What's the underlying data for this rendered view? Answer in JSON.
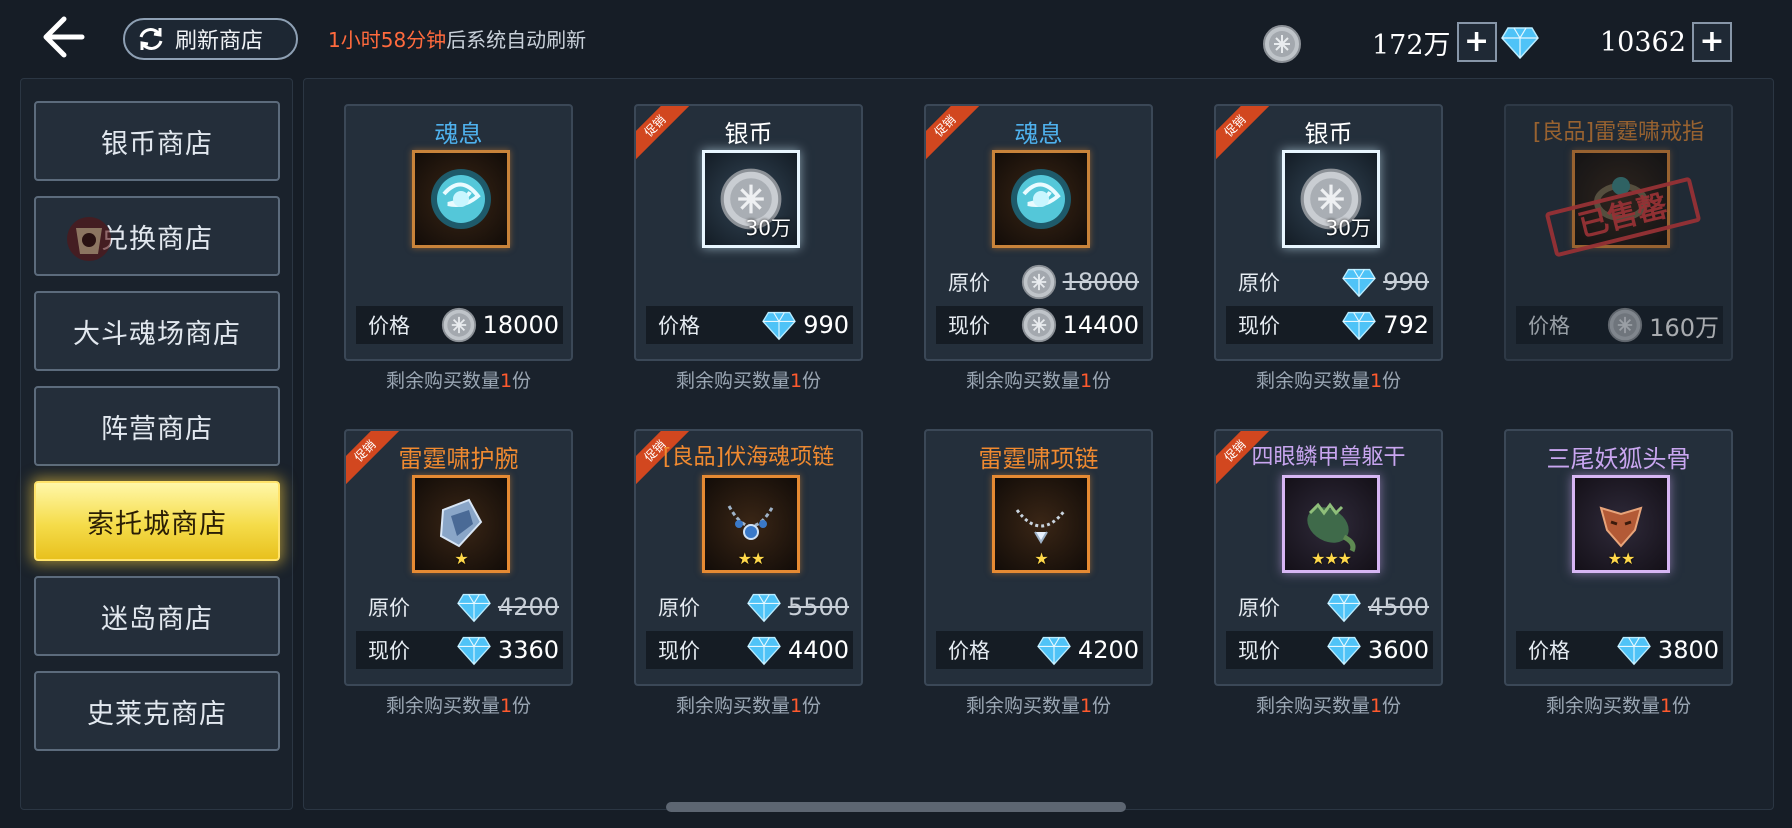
{
  "header": {
    "refresh_label": "刷新商店",
    "refresh_time": "1小时58分钟",
    "refresh_suffix": "后系统自动刷新",
    "silver_amount": "172万",
    "diamond_amount": "10362"
  },
  "sidebar": {
    "items": [
      {
        "label": "银币商店",
        "active": false
      },
      {
        "label": "兑换商店",
        "active": false
      },
      {
        "label": "大斗魂场商店",
        "active": false
      },
      {
        "label": "阵营商店",
        "active": false
      },
      {
        "label": "索托城商店",
        "active": true
      },
      {
        "label": "迷岛商店",
        "active": false
      },
      {
        "label": "史莱克商店",
        "active": false
      }
    ]
  },
  "labels": {
    "price": "价格",
    "original_price": "原价",
    "current_price": "现价",
    "promo": "促销",
    "sold_out": "已售罄",
    "remain_prefix": "剩余购买数量",
    "remain_suffix": "份"
  },
  "items": [
    {
      "name": "魂息",
      "title_color": "#4fb2ee",
      "icon": "soul-orb-icon",
      "frame": "copper",
      "currency": "silver",
      "price": "18000",
      "remaining": "1"
    },
    {
      "name": "银币",
      "title_color": "#ffffff",
      "icon": "silver-coin-icon",
      "frame": "white",
      "qty": "30万",
      "promo": true,
      "currency": "diamond",
      "price": "990",
      "remaining": "1"
    },
    {
      "name": "魂息",
      "title_color": "#4fb2ee",
      "icon": "soul-orb-icon",
      "frame": "copper",
      "promo": true,
      "currency": "silver",
      "original_price": "18000",
      "current_price": "14400",
      "remaining": "1"
    },
    {
      "name": "银币",
      "title_color": "#ffffff",
      "icon": "silver-coin-icon",
      "frame": "white",
      "qty": "30万",
      "promo": true,
      "currency": "diamond",
      "original_price": "990",
      "current_price": "792",
      "remaining": "1"
    },
    {
      "name": "[良品]雷霆啸戒指",
      "title_color": "#e58a33",
      "icon": "ring-icon",
      "frame": "orange",
      "sold_out": true,
      "currency": "silver",
      "price": "160万"
    },
    {
      "name": "雷霆啸护腕",
      "title_color": "#f08a30",
      "icon": "bracer-icon",
      "frame": "orange",
      "stars": 1,
      "promo": true,
      "currency": "diamond",
      "original_price": "4200",
      "current_price": "3360",
      "remaining": "1"
    },
    {
      "name": "[良品]伏海魂项链",
      "title_color": "#f08a30",
      "icon": "necklace-icon",
      "frame": "orange",
      "stars": 2,
      "promo": true,
      "currency": "diamond",
      "original_price": "5500",
      "current_price": "4400",
      "remaining": "1"
    },
    {
      "name": "雷霆啸项链",
      "title_color": "#f08a30",
      "icon": "necklace-icon",
      "frame": "orange",
      "stars": 1,
      "currency": "diamond",
      "price": "4200",
      "remaining": "1"
    },
    {
      "name": "四眼鳞甲兽躯干",
      "title_color": "#c9a6f0",
      "icon": "beast-torso-icon",
      "frame": "purple",
      "stars": 3,
      "promo": true,
      "currency": "diamond",
      "original_price": "4500",
      "current_price": "3600",
      "remaining": "1"
    },
    {
      "name": "三尾妖狐头骨",
      "title_color": "#c9a6f0",
      "icon": "fox-skull-icon",
      "frame": "purple",
      "stars": 2,
      "currency": "diamond",
      "price": "3800",
      "remaining": "1"
    }
  ]
}
